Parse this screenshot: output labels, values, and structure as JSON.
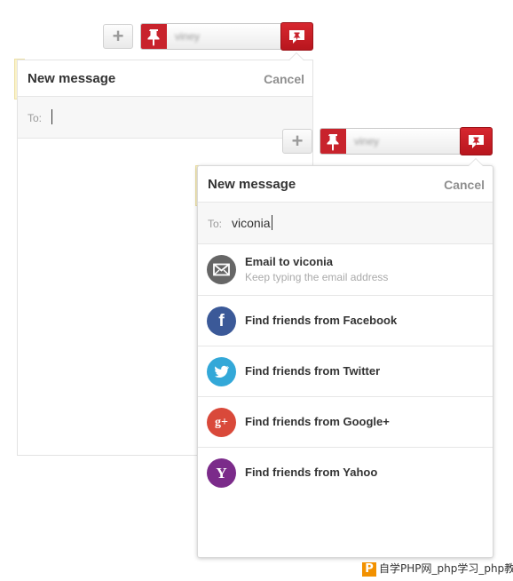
{
  "toolbar": {
    "add_label": "+",
    "user_name": "viney",
    "add_icon": "plus-icon",
    "pin_icon": "pushpin-icon",
    "message_icon": "message-pin-icon"
  },
  "back_panel": {
    "title": "New message",
    "cancel": "Cancel",
    "to_label": "To:",
    "to_value": ""
  },
  "front_panel": {
    "title": "New message",
    "cancel": "Cancel",
    "to_label": "To:",
    "to_value": "viconia",
    "items": [
      {
        "title": "Email to viconia",
        "subtitle": "Keep typing the email address",
        "icon": "envelope-icon",
        "color": "#666666"
      },
      {
        "title": "Find friends from Facebook",
        "icon": "facebook-icon",
        "glyph": "f",
        "color": "#3b5998"
      },
      {
        "title": "Find friends from Twitter",
        "icon": "twitter-icon",
        "glyph": "",
        "color": "#33a8d8"
      },
      {
        "title": "Find friends from Google+",
        "icon": "google-plus-icon",
        "glyph": "g+",
        "color": "#d9493a"
      },
      {
        "title": "Find friends from Yahoo",
        "icon": "yahoo-icon",
        "glyph": "Y",
        "color": "#7b2b8a"
      }
    ]
  },
  "colors": {
    "brand_red": "#c8232c",
    "notice_strip": "#fbf2c8"
  },
  "watermark": {
    "logo": "P",
    "text": "自学PHP网_php学习_php教程"
  }
}
